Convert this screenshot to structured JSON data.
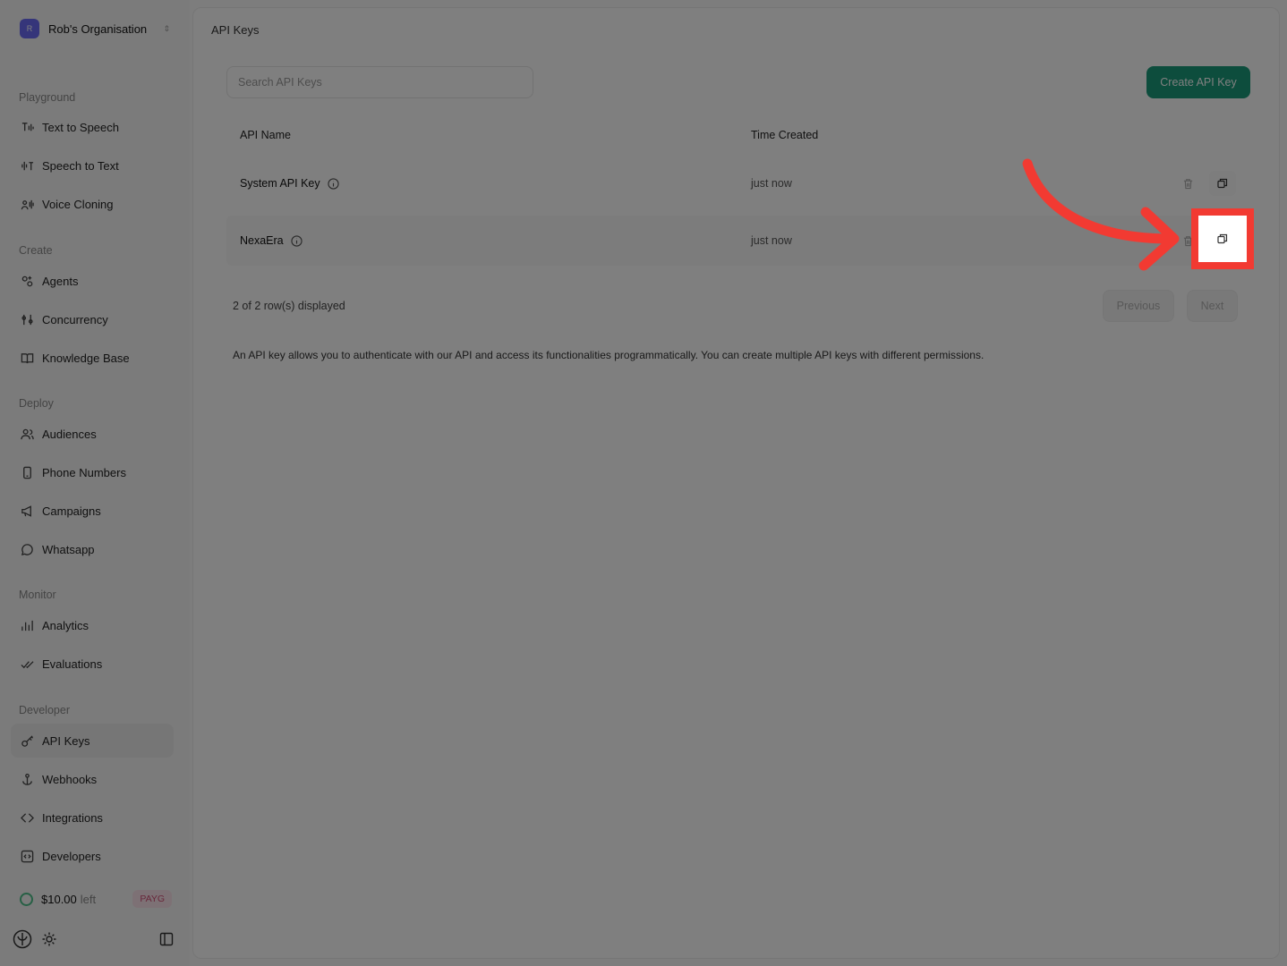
{
  "org": {
    "initial": "R",
    "name": "Rob's Organisation"
  },
  "sidebar": {
    "sections": [
      {
        "title": "Playground",
        "items": [
          {
            "label": "Text to Speech",
            "icon": "text-to-speech-icon"
          },
          {
            "label": "Speech to Text",
            "icon": "speech-to-text-icon"
          },
          {
            "label": "Voice Cloning",
            "icon": "voice-cloning-icon"
          }
        ]
      },
      {
        "title": "Create",
        "items": [
          {
            "label": "Agents",
            "icon": "agents-icon"
          },
          {
            "label": "Concurrency",
            "icon": "concurrency-icon"
          },
          {
            "label": "Knowledge Base",
            "icon": "book-icon"
          }
        ]
      },
      {
        "title": "Deploy",
        "items": [
          {
            "label": "Audiences",
            "icon": "users-icon"
          },
          {
            "label": "Phone Numbers",
            "icon": "phone-icon"
          },
          {
            "label": "Campaigns",
            "icon": "megaphone-icon"
          },
          {
            "label": "Whatsapp",
            "icon": "chat-bubble-icon"
          }
        ]
      },
      {
        "title": "Monitor",
        "items": [
          {
            "label": "Analytics",
            "icon": "bar-chart-icon"
          },
          {
            "label": "Evaluations",
            "icon": "checkmarks-icon"
          }
        ]
      },
      {
        "title": "Developer",
        "items": [
          {
            "label": "API Keys",
            "icon": "key-icon",
            "active": true
          },
          {
            "label": "Webhooks",
            "icon": "anchor-icon"
          },
          {
            "label": "Integrations",
            "icon": "integrations-icon"
          },
          {
            "label": "Developers",
            "icon": "code-icon"
          }
        ]
      }
    ]
  },
  "credits": {
    "amount": "$10.00",
    "suffix": "left",
    "plan": "PAYG"
  },
  "main": {
    "title": "API Keys",
    "search_placeholder": "Search API Keys",
    "create_label": "Create API Key",
    "columns": {
      "name": "API Name",
      "time": "Time Created"
    },
    "rows": [
      {
        "name": "System API Key",
        "time": "just now"
      },
      {
        "name": "NexaEra",
        "time": "just now"
      }
    ],
    "rows_displayed": "2 of 2 row(s) displayed",
    "previous_label": "Previous",
    "next_label": "Next",
    "description": "An API key allows you to authenticate with our API and access its functionalities programmatically. You can create multiple API keys with different permissions."
  },
  "colors": {
    "accent": "#1a9a7a",
    "highlight": "#f23a32"
  }
}
